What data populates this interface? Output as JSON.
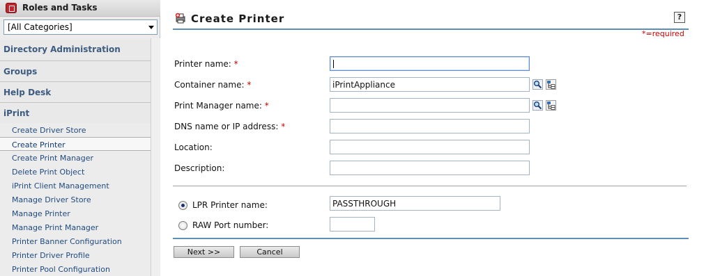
{
  "sidebar": {
    "header_title": "Roles and Tasks",
    "category_select": "[All Categories]",
    "categories": [
      {
        "label": "Directory Administration"
      },
      {
        "label": "Groups"
      },
      {
        "label": "Help Desk"
      },
      {
        "label": "iPrint"
      }
    ],
    "items": [
      {
        "label": "Create Driver Store"
      },
      {
        "label": "Create Printer"
      },
      {
        "label": "Create Print Manager"
      },
      {
        "label": "Delete Print Object"
      },
      {
        "label": "iPrint Client Management"
      },
      {
        "label": "Manage Driver Store"
      },
      {
        "label": "Manage Printer"
      },
      {
        "label": "Manage Print Manager"
      },
      {
        "label": "Printer Banner Configuration"
      },
      {
        "label": "Printer Driver Profile"
      },
      {
        "label": "Printer Pool Configuration"
      }
    ]
  },
  "main": {
    "title": "Create Printer",
    "help_label": "?",
    "required_note": "*=required",
    "required_mark": "*",
    "fields": {
      "printer_name": {
        "label": "Printer name:",
        "value": ""
      },
      "container_name": {
        "label": "Container name:",
        "value": "iPrintAppliance"
      },
      "print_manager_name": {
        "label": "Print Manager name:",
        "value": ""
      },
      "dns_ip": {
        "label": "DNS name or IP address:",
        "value": ""
      },
      "location": {
        "label": "Location:",
        "value": ""
      },
      "description": {
        "label": "Description:",
        "value": ""
      }
    },
    "lpr": {
      "label": "LPR Printer name:",
      "value": "PASSTHROUGH",
      "selected": true
    },
    "raw": {
      "label": "RAW Port number:",
      "value": ""
    },
    "buttons": {
      "next": "Next >>",
      "cancel": "Cancel"
    }
  },
  "colors": {
    "accent_rule": "#5b8fb8",
    "required": "#cc0000",
    "nav_link": "#1f4a80"
  },
  "icons": [
    "roles-icon",
    "create-printer-icon",
    "help-icon",
    "search-icon",
    "browse-tree-icon"
  ]
}
